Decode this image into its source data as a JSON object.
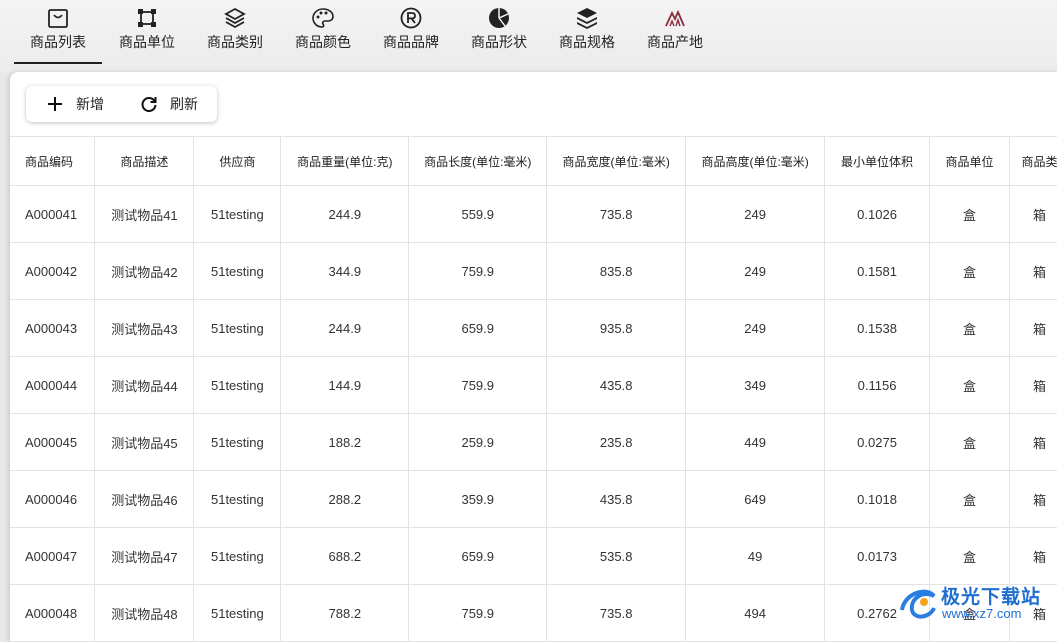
{
  "tabs": [
    {
      "label": "商品列表",
      "icon": "bag-icon",
      "active": true
    },
    {
      "label": "商品单位",
      "icon": "frame-icon",
      "active": false
    },
    {
      "label": "商品类别",
      "icon": "layers-icon",
      "active": false
    },
    {
      "label": "商品颜色",
      "icon": "palette-icon",
      "active": false
    },
    {
      "label": "商品品牌",
      "icon": "registered-icon",
      "active": false
    },
    {
      "label": "商品形状",
      "icon": "pie-icon",
      "active": false
    },
    {
      "label": "商品规格",
      "icon": "stack-icon",
      "active": false
    },
    {
      "label": "商品产地",
      "icon": "mountain-icon",
      "active": false
    }
  ],
  "toolbar": {
    "add_label": "新增",
    "refresh_label": "刷新"
  },
  "table": {
    "headers": [
      "商品编码",
      "商品描述",
      "供应商",
      "商品重量(单位:克)",
      "商品长度(单位:毫米)",
      "商品宽度(单位:毫米)",
      "商品高度(单位:毫米)",
      "最小单位体积",
      "商品单位",
      "商品类"
    ],
    "rows": [
      [
        "A000041",
        "测试物品41",
        "51testing",
        "244.9",
        "559.9",
        "735.8",
        "249",
        "0.1026",
        "盒",
        "箱"
      ],
      [
        "A000042",
        "测试物品42",
        "51testing",
        "344.9",
        "759.9",
        "835.8",
        "249",
        "0.1581",
        "盒",
        "箱"
      ],
      [
        "A000043",
        "测试物品43",
        "51testing",
        "244.9",
        "659.9",
        "935.8",
        "249",
        "0.1538",
        "盒",
        "箱"
      ],
      [
        "A000044",
        "测试物品44",
        "51testing",
        "144.9",
        "759.9",
        "435.8",
        "349",
        "0.1156",
        "盒",
        "箱"
      ],
      [
        "A000045",
        "测试物品45",
        "51testing",
        "188.2",
        "259.9",
        "235.8",
        "449",
        "0.0275",
        "盒",
        "箱"
      ],
      [
        "A000046",
        "测试物品46",
        "51testing",
        "288.2",
        "359.9",
        "435.8",
        "649",
        "0.1018",
        "盒",
        "箱"
      ],
      [
        "A000047",
        "测试物品47",
        "51testing",
        "688.2",
        "659.9",
        "535.8",
        "49",
        "0.0173",
        "盒",
        "箱"
      ],
      [
        "A000048",
        "测试物品48",
        "51testing",
        "788.2",
        "759.9",
        "735.8",
        "494",
        "0.2762",
        "盒",
        "箱"
      ]
    ]
  },
  "watermark": {
    "title": "极光下载站",
    "url": "www.xz7.com"
  }
}
